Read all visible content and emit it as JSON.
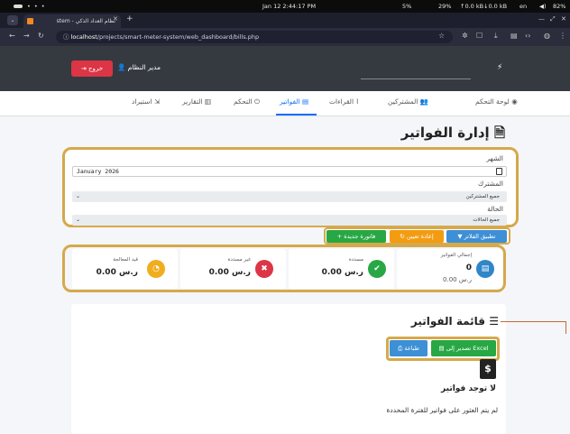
{
  "os": {
    "datetime": "Jan 12   2:44:17 PM",
    "cpu": "5%",
    "mem": "29%",
    "net_up": "↑0.0 kB",
    "net_down": "↓0.0 kB",
    "lang": "en",
    "battery": "82%"
  },
  "browser": {
    "tab_title": "نظام العداد الذكي - stem",
    "url_host": "localhost",
    "url_path": "/projects/smart-meter-system/web_dashboard/bills.php"
  },
  "header": {
    "logout_label": "خروج",
    "admin_label": "مدير النظام"
  },
  "nav": [
    {
      "label": "لوحة التحكم",
      "icon": "dashboard-icon"
    },
    {
      "label": "المشتركين",
      "icon": "users-icon"
    },
    {
      "label": "القراءات",
      "icon": "chart-line-icon"
    },
    {
      "label": "الفواتير",
      "icon": "file-invoice-icon",
      "active": true
    },
    {
      "label": "التحكم",
      "icon": "power-icon"
    },
    {
      "label": "التقارير",
      "icon": "chart-bar-icon"
    },
    {
      "label": "استيراد",
      "icon": "import-icon"
    }
  ],
  "page": {
    "title": "إدارة الفواتير"
  },
  "filters": {
    "month_label": "الشهر",
    "month_value": "January 2026",
    "subscriber_label": "المشترك",
    "subscriber_value": "جميع المشتركين",
    "status_label": "الحالة",
    "status_value": "جميع الحالات"
  },
  "actions": {
    "apply": "تطبيق الفلاتر",
    "reset": "إعادة تعيين",
    "new_bill": "فاتورة جديدة"
  },
  "stats": {
    "total": {
      "title": "إجمالي الفواتير",
      "value": "0",
      "sub": "0.00 ر.س",
      "color": "#2f86c9"
    },
    "paid": {
      "title": "مسددة",
      "value": "0.00 ر.س",
      "color": "#28a745"
    },
    "unpaid": {
      "title": "غير مسددة",
      "value": "0.00 ر.س",
      "color": "#dc3545"
    },
    "pending": {
      "title": "قيد المعالجة",
      "value": "0.00 ر.س",
      "color": "#f0ad1e"
    }
  },
  "bills": {
    "title": "قائمة الفواتير",
    "export_excel": "تصدير إلى Excel",
    "print": "طباعة",
    "empty_title": "لا توجد فواتير",
    "empty_text": "لم يتم العثور على فواتير للفترة المحددة"
  }
}
